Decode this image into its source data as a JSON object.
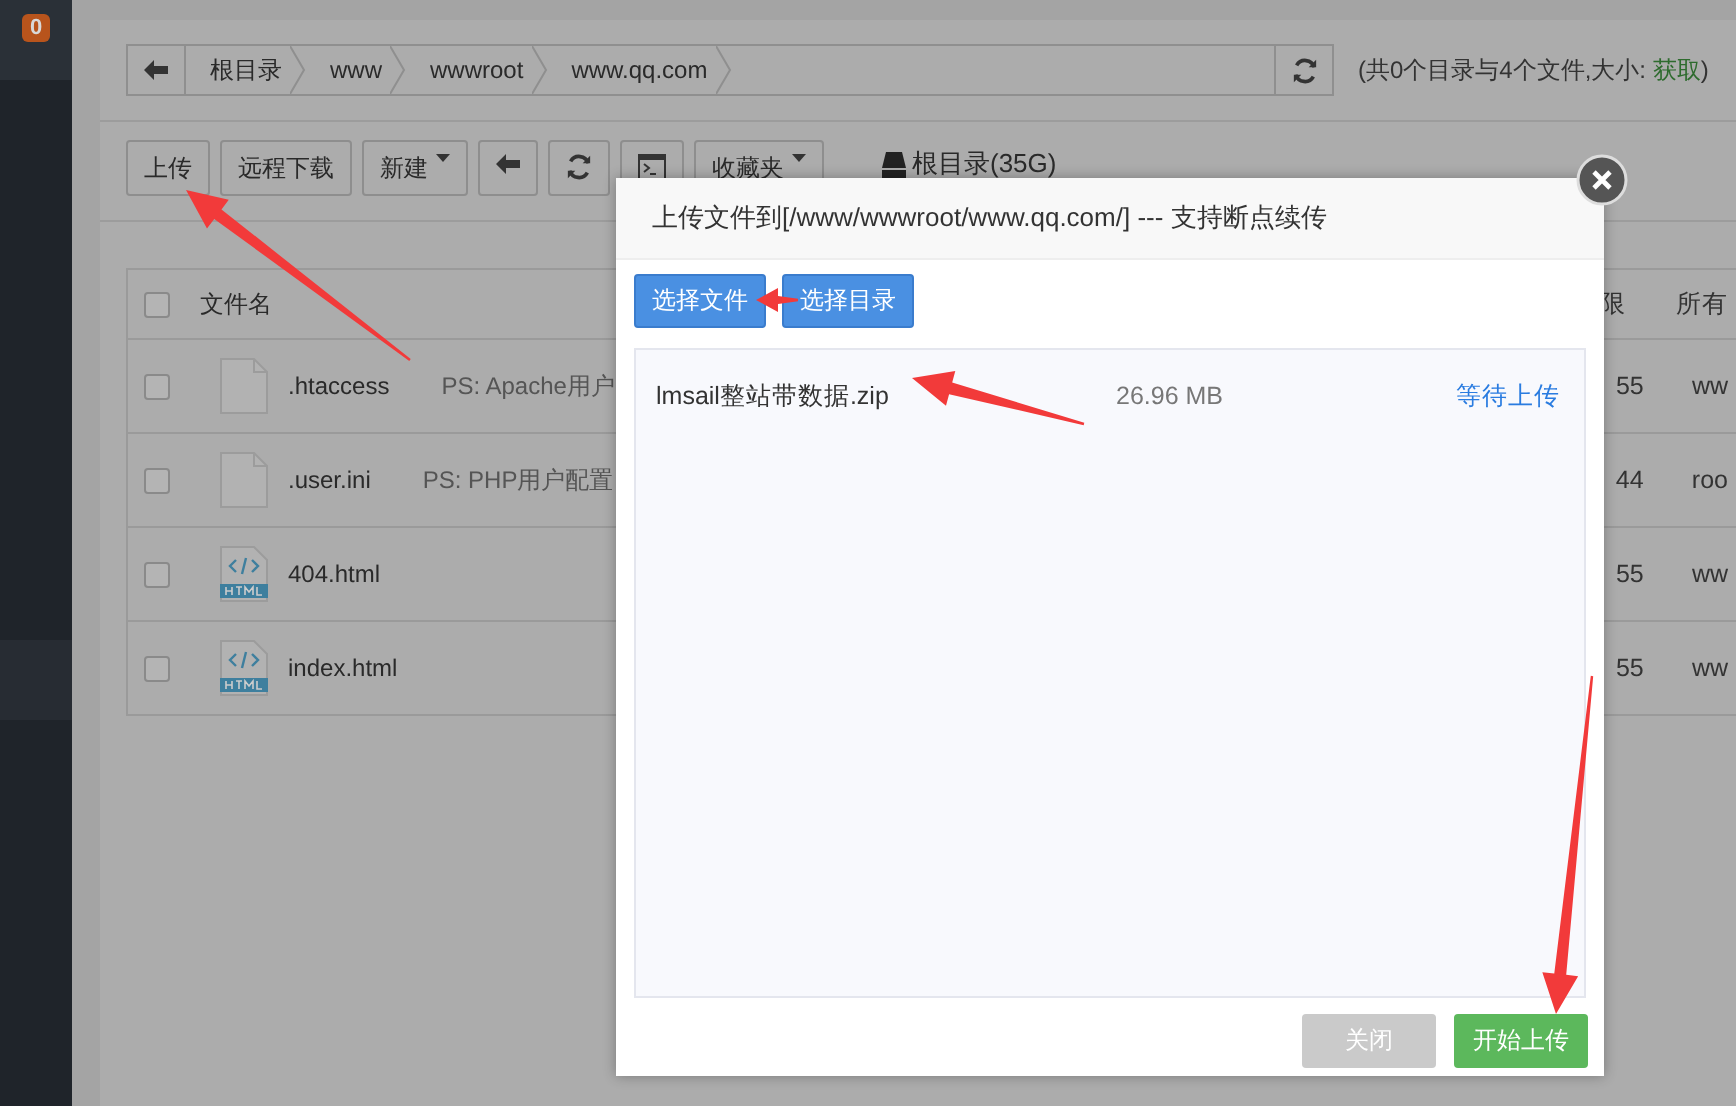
{
  "sidebar": {
    "badge": "0"
  },
  "breadcrumb": {
    "items": [
      "根目录",
      "www",
      "wwwroot",
      "www.qq.com"
    ]
  },
  "summary": {
    "text": "(共0个目录与4个文件,大小: ",
    "link": "获取",
    "end": ")"
  },
  "toolbar": {
    "buttons": [
      {
        "kind": "text",
        "label": "上传"
      },
      {
        "kind": "text",
        "label": "远程下载"
      },
      {
        "kind": "dropdown",
        "label": "新建"
      },
      {
        "kind": "back"
      },
      {
        "kind": "refresh"
      },
      {
        "kind": "terminal"
      },
      {
        "kind": "dropdown",
        "label": "收藏夹"
      }
    ],
    "disk": "根目录(35G)"
  },
  "table": {
    "select_all_checked": false,
    "columns": [
      "文件名",
      "限",
      "所有"
    ],
    "rows": [
      {
        "kind": "file",
        "name": ".htaccess",
        "note": "PS: Apache用户",
        "perm": "55",
        "owner": "ww",
        "checked": false
      },
      {
        "kind": "file",
        "name": ".user.ini",
        "note": "PS: PHP用户配置",
        "perm": "44",
        "owner": "roo",
        "checked": false
      },
      {
        "kind": "html",
        "name": "404.html",
        "perm": "55",
        "owner": "ww",
        "checked": false
      },
      {
        "kind": "html",
        "name": "index.html",
        "perm": "55",
        "owner": "ww",
        "checked": false
      }
    ]
  },
  "modal": {
    "title": "上传文件到[/www/wwwroot/www.qq.com/] --- 支持断点续传",
    "pick_buttons": [
      "选择文件",
      "选择目录"
    ],
    "files": [
      {
        "name": "lmsail整站带数据.zip",
        "size": "26.96 MB",
        "status": "等待上传"
      }
    ],
    "footer_buttons": [
      {
        "kind": "close",
        "label": "关闭"
      },
      {
        "kind": "primary",
        "label": "开始上传"
      }
    ]
  }
}
